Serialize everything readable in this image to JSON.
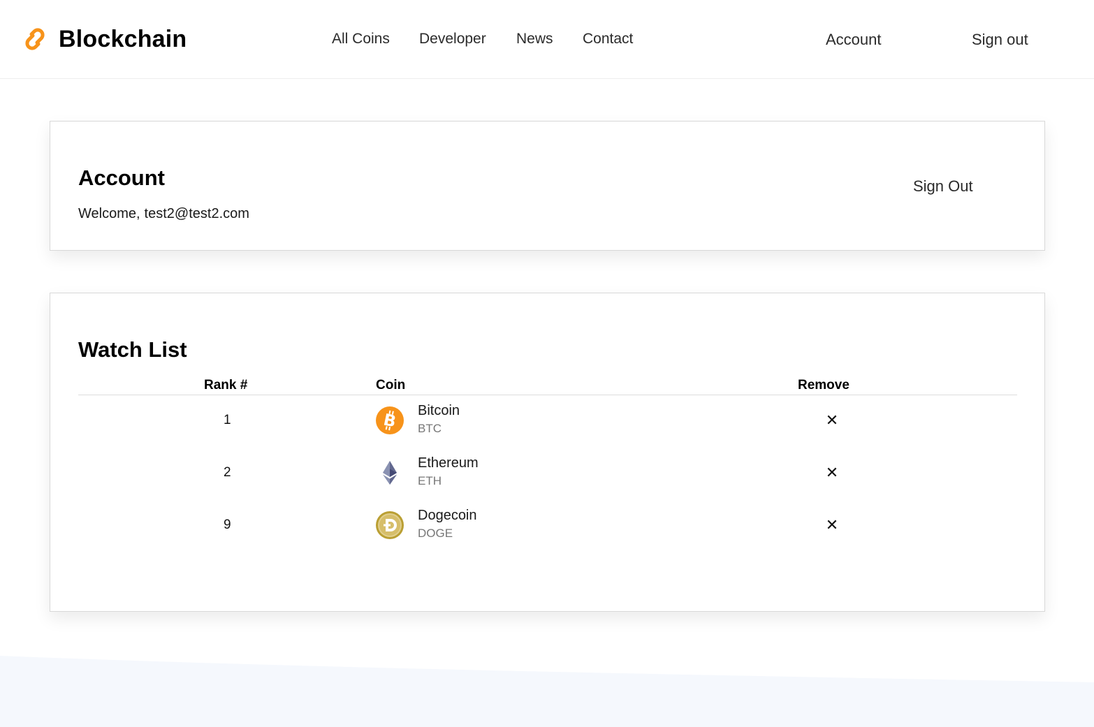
{
  "header": {
    "brand_name": "Blockchain",
    "brand_icon": "chain-link-icon",
    "brand_color": "#F7931A",
    "nav": {
      "all_coins": "All Coins",
      "developer": "Developer",
      "news": "News",
      "contact": "Contact",
      "account": "Account",
      "sign_out": "Sign out"
    }
  },
  "account": {
    "title": "Account",
    "welcome_label": "Welcome,",
    "email": "test2@test2.com",
    "sign_out_label": "Sign Out"
  },
  "watchlist": {
    "title": "Watch List",
    "columns": {
      "rank": "Rank #",
      "coin": "Coin",
      "remove": "Remove"
    },
    "rows": [
      {
        "rank": "1",
        "name": "Bitcoin",
        "symbol": "BTC",
        "icon": "bitcoin-icon",
        "remove_icon": "close-icon",
        "remove_glyph": "✕"
      },
      {
        "rank": "2",
        "name": "Ethereum",
        "symbol": "ETH",
        "icon": "ethereum-icon",
        "remove_icon": "close-icon",
        "remove_glyph": "✕"
      },
      {
        "rank": "9",
        "name": "Dogecoin",
        "symbol": "DOGE",
        "icon": "dogecoin-icon",
        "remove_icon": "close-icon",
        "remove_glyph": "✕"
      }
    ]
  },
  "colors": {
    "bitcoin": "#F7931A",
    "ethereum": "#627EEA",
    "dogecoin": "#C2A633",
    "footer_wave": "#F5F8FD"
  }
}
